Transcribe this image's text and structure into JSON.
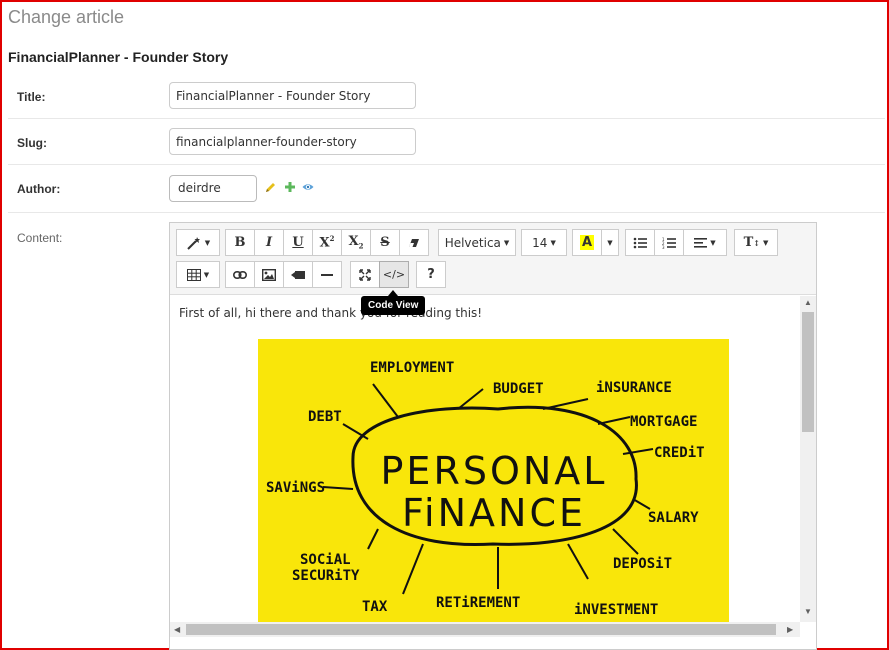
{
  "page": {
    "title": "Change article",
    "article_name": "FinancialPlanner - Founder Story"
  },
  "form": {
    "title": {
      "label": "Title:",
      "value": "FinancialPlanner - Founder Story"
    },
    "slug": {
      "label": "Slug:",
      "value": "financialplanner-founder-story"
    },
    "author": {
      "label": "Author:",
      "selected": "deirdre",
      "icons": [
        "pencil-icon",
        "plus-icon",
        "eye-icon"
      ],
      "icon_colors": {
        "pencil": "#e6c01a",
        "plus": "#5cb85c",
        "eye": "#337ab7"
      }
    },
    "content": {
      "label": "Content:"
    }
  },
  "editor": {
    "toolbar": {
      "font_name": "Helvetica",
      "font_size": "14",
      "color_button_glyph": "A",
      "buttons": [
        "magic-icon",
        "bold",
        "italic",
        "underline",
        "superscript",
        "subscript",
        "strikethrough",
        "eraser",
        "unordered-list",
        "ordered-list",
        "paragraph-align",
        "line-height",
        "table",
        "link",
        "picture",
        "video",
        "horizontal-rule",
        "fullscreen",
        "code-view",
        "help"
      ]
    },
    "tooltip": "Code View",
    "body_text": "First of all, hi there and thank you for reading this!",
    "image": {
      "center_line1": "PERSONAL",
      "center_line2": "FiNANCE",
      "words": [
        "EMPLOYMENT",
        "BUDGET",
        "iNSURANCE",
        "MORTGAGE",
        "CREDiT",
        "DEBT",
        "SAViNGS",
        "SALARY",
        "SOCiAL",
        "SECURiTY",
        "DEPOSiT",
        "TAX",
        "RETiREMENT",
        "iNVESTMENT"
      ],
      "background": "#f9e60a"
    }
  },
  "colors": {
    "frame": "#e00000",
    "highlight_yellow": "#ffff00"
  }
}
